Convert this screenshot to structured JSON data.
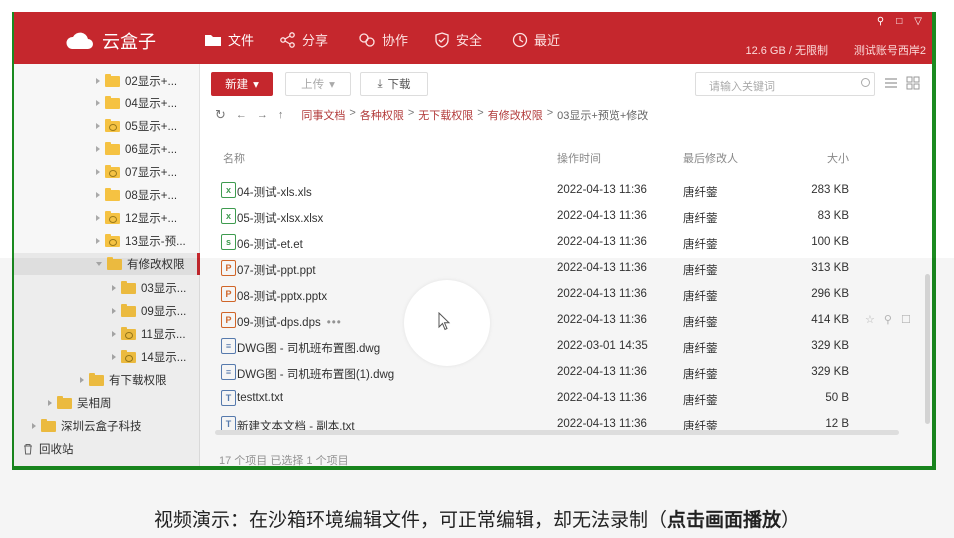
{
  "header": {
    "app_name": "云盒子",
    "nav": [
      {
        "label": "文件",
        "icon": "folder-icon"
      },
      {
        "label": "分享",
        "icon": "share-icon"
      },
      {
        "label": "协作",
        "icon": "collaborate-icon"
      },
      {
        "label": "安全",
        "icon": "shield-icon"
      },
      {
        "label": "最近",
        "icon": "clock-icon"
      }
    ],
    "quota": "12.6 GB / 无限制",
    "account": "测试账号西岸2"
  },
  "sidebar": {
    "items": [
      {
        "label": "02显示+...",
        "shared": false
      },
      {
        "label": "04显示+...",
        "shared": false
      },
      {
        "label": "05显示+...",
        "shared": true
      },
      {
        "label": "06显示+...",
        "shared": false
      },
      {
        "label": "07显示+...",
        "shared": true
      },
      {
        "label": "08显示+...",
        "shared": false
      },
      {
        "label": "12显示+...",
        "shared": true
      },
      {
        "label": "13显示-预...",
        "shared": true
      },
      {
        "label": "有修改权限",
        "shared": false
      },
      {
        "label": "03显示...",
        "shared": false
      },
      {
        "label": "09显示...",
        "shared": false
      },
      {
        "label": "11显示...",
        "shared": true
      },
      {
        "label": "14显示...",
        "shared": true
      },
      {
        "label": "有下载权限",
        "shared": false
      },
      {
        "label": "吴相周",
        "shared": false
      },
      {
        "label": "深圳云盒子科技",
        "shared": false
      }
    ],
    "recycle": "回收站"
  },
  "toolbar": {
    "new_label": "新建",
    "upload_label": "上传",
    "download_label": "下载",
    "search_placeholder": "请输入关键词"
  },
  "breadcrumb": {
    "items": [
      "同事文档",
      "各种权限",
      "无下载权限",
      "有修改权限"
    ],
    "current": "03显示+预览+修改"
  },
  "table": {
    "headers": {
      "name": "名称",
      "time": "操作时间",
      "user": "最后修改人",
      "size": "大小"
    },
    "rows": [
      {
        "icon": "xls-file-icon",
        "glyph": "x",
        "name": "04-测试-xls.xls",
        "time": "2022-04-13 11:36",
        "user": "唐纤蓥",
        "size": "283 KB"
      },
      {
        "icon": "xlsx-file-icon",
        "glyph": "x",
        "name": "05-测试-xlsx.xlsx",
        "time": "2022-04-13 11:36",
        "user": "唐纤蓥",
        "size": "83 KB"
      },
      {
        "icon": "et-file-icon",
        "glyph": "s",
        "name": "06-测试-et.et",
        "time": "2022-04-13 11:36",
        "user": "唐纤蓥",
        "size": "100 KB"
      },
      {
        "icon": "ppt-file-icon",
        "glyph": "P",
        "name": "07-测试-ppt.ppt",
        "time": "2022-04-13 11:36",
        "user": "唐纤蓥",
        "size": "313 KB"
      },
      {
        "icon": "pptx-file-icon",
        "glyph": "P",
        "name": "08-测试-pptx.pptx",
        "time": "2022-04-13 11:36",
        "user": "唐纤蓥",
        "size": "296 KB"
      },
      {
        "icon": "dps-file-icon",
        "glyph": "P",
        "name": "09-测试-dps.dps",
        "time": "2022-04-13 11:36",
        "user": "唐纤蓥",
        "size": "414 KB"
      },
      {
        "icon": "dwg-file-icon",
        "glyph": "≡",
        "name": "DWG图 - 司机班布置图.dwg",
        "time": "2022-03-01 14:35",
        "user": "唐纤蓥",
        "size": "329 KB"
      },
      {
        "icon": "dwg-file-icon",
        "glyph": "≡",
        "name": "DWG图 - 司机班布置图(1).dwg",
        "time": "2022-04-13 11:36",
        "user": "唐纤蓥",
        "size": "329 KB"
      },
      {
        "icon": "txt-file-icon",
        "glyph": "T",
        "name": "testtxt.txt",
        "time": "2022-04-13 11:36",
        "user": "唐纤蓥",
        "size": "50 B"
      },
      {
        "icon": "txt-file-icon",
        "glyph": "T",
        "name": "新建文本文档 - 副本.txt",
        "time": "2022-04-13 11:36",
        "user": "唐纤蓥",
        "size": "12 B"
      }
    ]
  },
  "status": "17 个项目 已选择 1 个项目",
  "caption": {
    "text": "视频演示：在沙箱环境编辑文件，可正常编辑，却无法录制（",
    "bold": "点击画面播放",
    "end": "）"
  },
  "colors": {
    "brand": "#c5272d",
    "frame": "#1a8a1f"
  }
}
